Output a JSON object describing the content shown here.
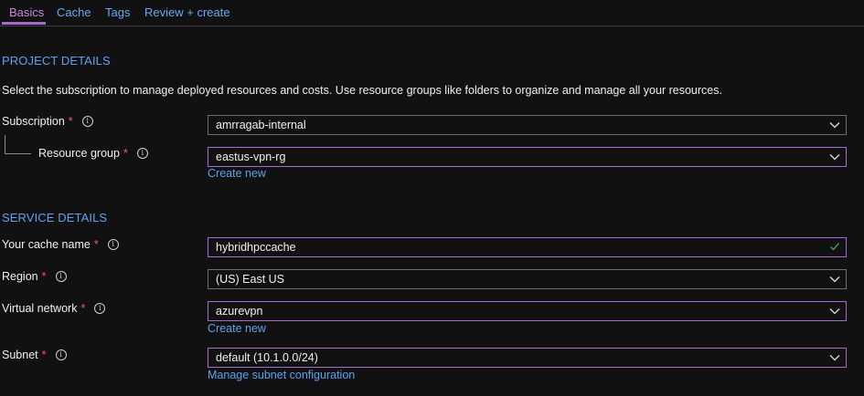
{
  "tabs": [
    {
      "label": "Basics"
    },
    {
      "label": "Cache"
    },
    {
      "label": "Tags"
    },
    {
      "label": "Review + create"
    }
  ],
  "project_details": {
    "title": "PROJECT DETAILS",
    "description": "Select the subscription to manage deployed resources and costs. Use resource groups like folders to organize and manage all your resources.",
    "subscription": {
      "label": "Subscription",
      "required": "*",
      "value": "amrragab-internal"
    },
    "resource_group": {
      "label": "Resource group",
      "required": "*",
      "value": "eastus-vpn-rg",
      "link": "Create new"
    }
  },
  "service_details": {
    "title": "SERVICE DETAILS",
    "cache_name": {
      "label": "Your cache name",
      "required": "*",
      "value": "hybridhpccache"
    },
    "region": {
      "label": "Region",
      "required": "*",
      "value": "(US) East US"
    },
    "virtual_network": {
      "label": "Virtual network",
      "required": "*",
      "value": "azurevpn",
      "link": "Create new"
    },
    "subnet": {
      "label": "Subnet",
      "required": "*",
      "value": "default (10.1.0.0/24)",
      "link": "Manage subnet configuration"
    }
  },
  "icons": {
    "info": "i"
  },
  "colors": {
    "accent_link": "#5fa1f0",
    "active_tab": "#c48bd9",
    "required": "#f25b5b",
    "focus_border": "#a06bd2",
    "valid_check": "#3fa34d"
  }
}
